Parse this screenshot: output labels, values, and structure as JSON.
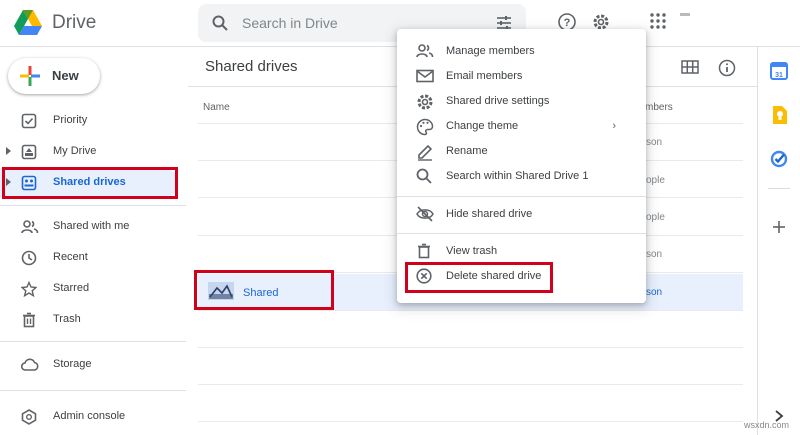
{
  "header": {
    "app_title": "Drive",
    "search_placeholder": "Search in Drive",
    "icons": [
      "search-icon",
      "tune-icon",
      "help-icon",
      "settings-icon",
      "apps-icon"
    ]
  },
  "sidebar": {
    "new_label": "New",
    "items": [
      {
        "label": "Priority",
        "icon": "check-square-icon"
      },
      {
        "label": "My Drive",
        "icon": "drive-icon"
      },
      {
        "label": "Shared drives",
        "icon": "shared-drives-icon",
        "active": true
      },
      {
        "label": "Shared with me",
        "icon": "people-icon"
      },
      {
        "label": "Recent",
        "icon": "clock-icon"
      },
      {
        "label": "Starred",
        "icon": "star-icon"
      },
      {
        "label": "Trash",
        "icon": "trash-icon"
      },
      {
        "label": "Storage",
        "icon": "cloud-icon"
      },
      {
        "label": "Admin console",
        "icon": "admin-icon"
      }
    ]
  },
  "main": {
    "title": "Shared drives",
    "columns": {
      "name": "Name",
      "owner": "mbers"
    },
    "rows": [
      {
        "name": "",
        "owner": "son"
      },
      {
        "name": "",
        "owner": "ople"
      },
      {
        "name": "",
        "owner": "ople"
      },
      {
        "name": "",
        "owner": "son"
      },
      {
        "name": "Shared",
        "owner": "son",
        "selected": true
      }
    ]
  },
  "context_menu": {
    "items": [
      {
        "label": "Manage members",
        "icon": "people-icon"
      },
      {
        "label": "Email members",
        "icon": "mail-icon"
      },
      {
        "label": "Shared drive settings",
        "icon": "settings-icon"
      },
      {
        "label": "Change theme",
        "icon": "palette-icon",
        "submenu": true
      },
      {
        "label": "Rename",
        "icon": "pencil-icon"
      },
      {
        "label": "Search within Shared Drive 1",
        "icon": "search-icon"
      },
      {
        "label": "Hide shared drive",
        "icon": "eye-off-icon"
      },
      {
        "label": "View trash",
        "icon": "trash-icon"
      },
      {
        "label": "Delete shared drive",
        "icon": "delete-circle-icon"
      }
    ],
    "chevron": "›"
  },
  "rail": {
    "calendar_day": "31",
    "icons": [
      "calendar-icon",
      "keep-icon",
      "tasks-icon",
      "add-icon",
      "chevron-right-icon"
    ]
  },
  "watermark": "wsxdn.com",
  "colors": {
    "highlight": "#d0021b",
    "accent": "#1967d2",
    "selected_bg": "#e8f0fe"
  }
}
